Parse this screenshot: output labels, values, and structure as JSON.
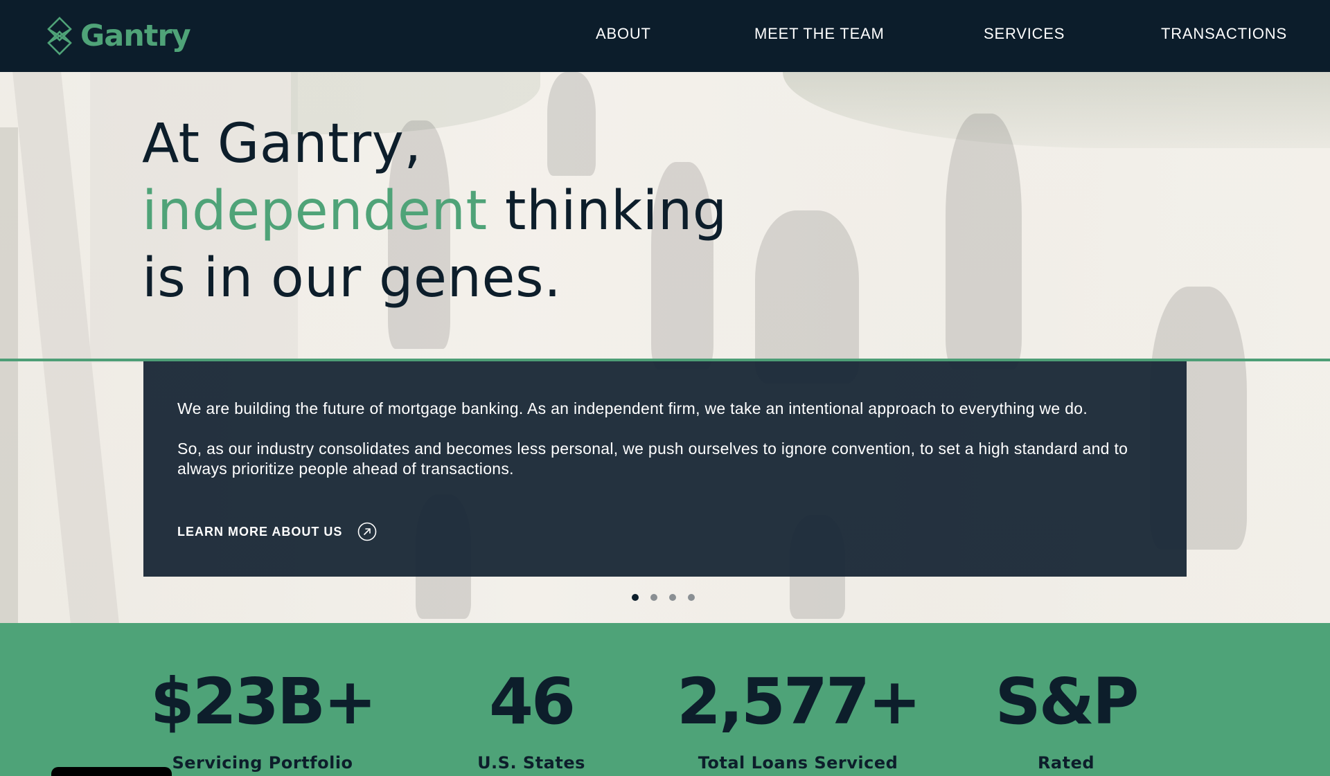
{
  "brand": {
    "name": "Gantry",
    "color": "#4fa378",
    "header_bg": "#0c1d2b"
  },
  "nav": {
    "items": [
      {
        "label": "ABOUT"
      },
      {
        "label": "MEET THE TEAM"
      },
      {
        "label": "SERVICES"
      },
      {
        "label": "TRANSACTIONS"
      }
    ]
  },
  "hero": {
    "line1": "At Gantry,",
    "line2_accent": "independent",
    "line2_rest": " thinking",
    "line3": "is in our genes.",
    "paragraph1": "We are building the future of mortgage banking. As an independent firm, we take an intentional approach to everything we do.",
    "paragraph2": "So, as our industry consolidates and becomes less personal, we push ourselves to ignore convention, to set a high standard and to always prioritize people ahead of transactions.",
    "cta_label": "LEARN MORE ABOUT US",
    "cta_icon": "circle-arrow-icon",
    "slides_total": 4,
    "slide_active": 1
  },
  "stats": {
    "bg": "#4ea378",
    "items": [
      {
        "value": "$23B+",
        "label": "Servicing Portfolio"
      },
      {
        "value": "46",
        "label": "U.S. States"
      },
      {
        "value": "2,577+",
        "label": "Total Loans Serviced"
      },
      {
        "value": "S&P",
        "label": "Rated"
      }
    ]
  }
}
